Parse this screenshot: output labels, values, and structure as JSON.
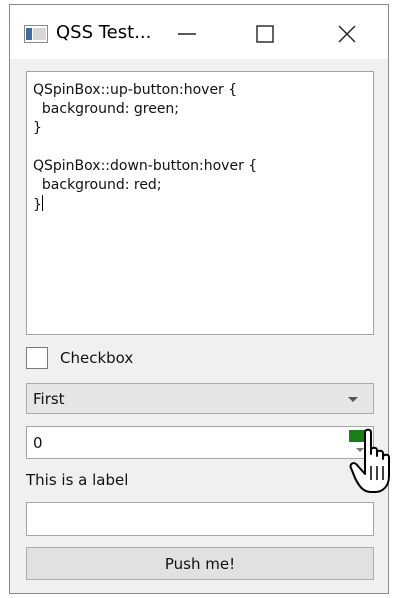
{
  "window": {
    "title": "QSS Test...",
    "controls": {
      "minimize": "minimize",
      "maximize": "maximize",
      "close": "close"
    }
  },
  "editor": {
    "lines": [
      "QSpinBox::up-button:hover {",
      "  background: green;",
      "}",
      "",
      "QSpinBox::down-button:hover {",
      "  background: red;",
      "}"
    ]
  },
  "checkbox": {
    "label": "Checkbox",
    "checked": false
  },
  "combo": {
    "value": "First"
  },
  "spinbox": {
    "value": "0",
    "up_color": "#168016"
  },
  "label": {
    "text": "This is a label"
  },
  "line_edit": {
    "value": ""
  },
  "button": {
    "label": "Push me!"
  },
  "icons": [
    "app-icon",
    "minimize-icon",
    "maximize-icon",
    "close-icon",
    "chevron-down-icon",
    "mouse-pointer-icon"
  ]
}
